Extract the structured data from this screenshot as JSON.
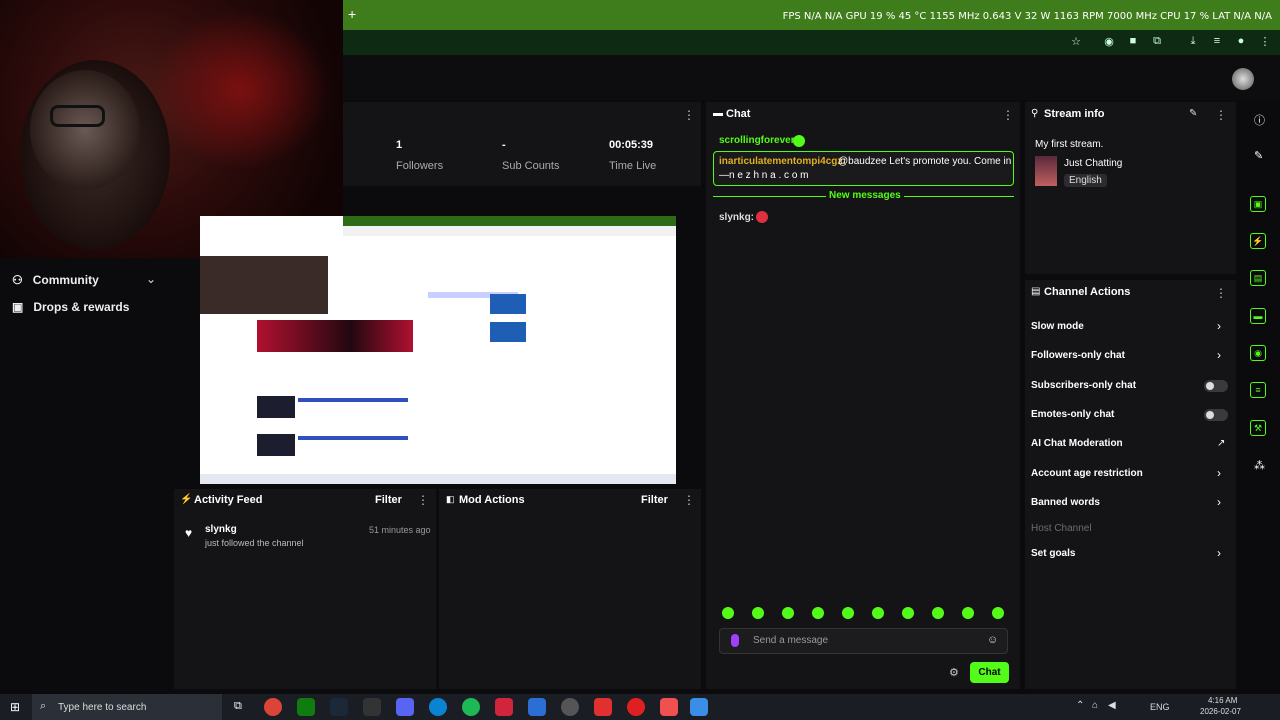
{
  "hud": {
    "text": "FPS N/A N/A    GPU 19 % 45 °C 1155 MHz 0.643 V 32 W 1163 RPM 7000 MHz    CPU 17 %  LAT N/A N/A"
  },
  "topbar": {
    "new_tab_label": "+"
  },
  "left_nav": {
    "items": [
      {
        "label": "Community",
        "icon": "people-icon"
      },
      {
        "label": "Drops & rewards",
        "icon": "gift-icon"
      }
    ]
  },
  "stats": {
    "followers_value": "1",
    "followers_label": "Followers",
    "subs_value": "-",
    "subs_label": "Sub Counts",
    "time_value": "00:05:39",
    "time_label": "Time Live"
  },
  "activity_feed": {
    "title": "Activity Feed",
    "filter_label": "Filter",
    "entries": [
      {
        "user": "slynkg",
        "action": "just followed the channel",
        "time": "51 minutes ago"
      }
    ]
  },
  "mod_actions": {
    "title": "Mod Actions",
    "filter_label": "Filter"
  },
  "chat": {
    "title": "Chat",
    "messages": [
      {
        "user": "scrollingforever:",
        "text": "",
        "color": "#53fc18"
      },
      {
        "user": "inarticulatementompi4cgz:",
        "text": "@baudzee Let's promote you. Come in",
        "text2": "—n e z h n a . c o m",
        "color": "#e0b020",
        "highlighted": true
      },
      {
        "user": "slynkg:",
        "text": "",
        "color": "#dddddd"
      }
    ],
    "new_messages_label": "New messages",
    "input_placeholder": "Send a message",
    "send_label": "Chat"
  },
  "stream_info": {
    "title": "Stream info",
    "stream_title": "My first stream.",
    "category": "Just Chatting",
    "language": "English"
  },
  "channel_actions": {
    "title": "Channel Actions",
    "items": [
      {
        "label": "Slow mode",
        "control": "chevron"
      },
      {
        "label": "Followers-only chat",
        "control": "chevron"
      },
      {
        "label": "Subscribers-only chat",
        "control": "toggle"
      },
      {
        "label": "Emotes-only chat",
        "control": "toggle"
      },
      {
        "label": "AI Chat Moderation",
        "control": "external"
      },
      {
        "label": "Account age restriction",
        "control": "chevron"
      },
      {
        "label": "Banned words",
        "control": "chevron"
      },
      {
        "label": "Host Channel",
        "control": "none",
        "disabled": true
      },
      {
        "label": "Set goals",
        "control": "chevron"
      }
    ]
  },
  "taskbar": {
    "search_placeholder": "Type here to search",
    "tray_lang": "ENG",
    "time": "4:16 AM",
    "date": "2026-02-07"
  },
  "colors": {
    "accent": "#53fc18",
    "panel": "#141416",
    "topbar": "#3f7d1c"
  }
}
